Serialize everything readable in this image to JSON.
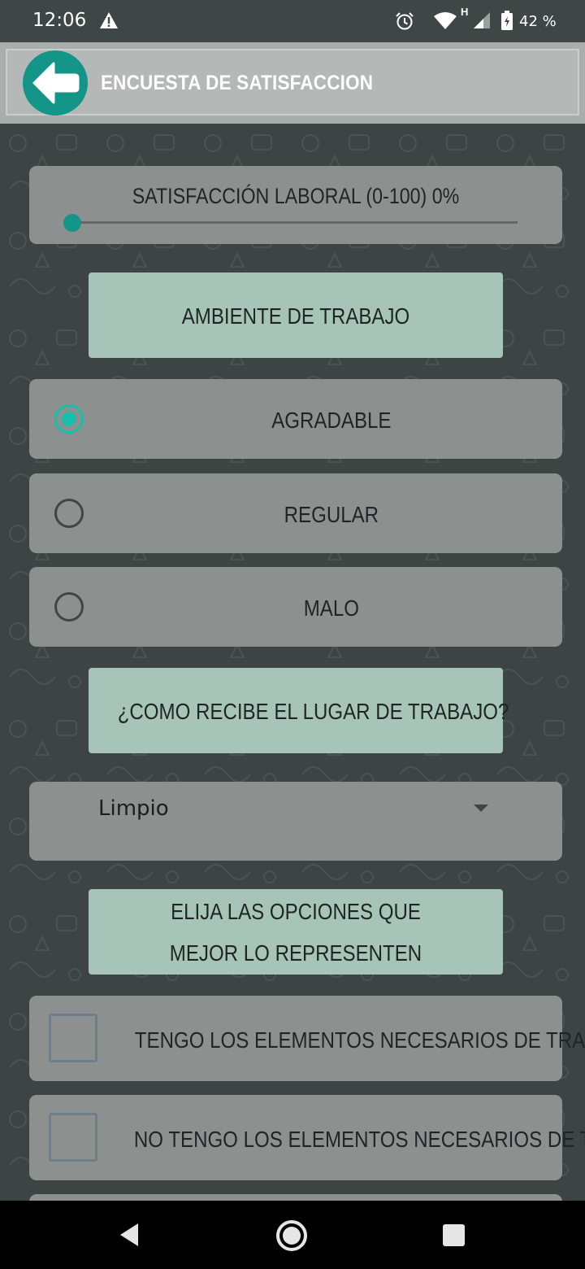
{
  "status_bar": {
    "time": "12:06",
    "network_type": "H",
    "battery_percent": "42 %",
    "icons": [
      "warning-icon",
      "alarm-icon",
      "wifi-icon",
      "signal-icon",
      "battery-icon"
    ]
  },
  "app_bar": {
    "title": "ENCUESTA DE SATISFACCION",
    "back_icon": "arrow-left-icon",
    "accent_color": "#139688"
  },
  "slider": {
    "label": "SATISFACCIÓN LABORAL (0-100) 0%",
    "value": 0,
    "min": 0,
    "max": 100
  },
  "section_ambiente": {
    "title": "AMBIENTE DE TRABAJO"
  },
  "radio_options": [
    {
      "label": "AGRADABLE",
      "checked": true
    },
    {
      "label": "REGULAR",
      "checked": false
    },
    {
      "label": "MALO",
      "checked": false
    }
  ],
  "section_lugar": {
    "title": "¿COMO RECIBE EL LUGAR DE TRABAJO?"
  },
  "spinner": {
    "selected": "Limpio"
  },
  "section_opciones": {
    "title_line1": "ELIJA LAS OPCIONES QUE",
    "title_line2": "MEJOR LO REPRESENTEN"
  },
  "checkboxes": [
    {
      "label": "TENGO LOS ELEMENTOS NECESARIOS DE TRABAJO",
      "checked": false
    },
    {
      "label": "NO TENGO LOS ELEMENTOS NECESARIOS DE TRABAJO",
      "checked": false
    }
  ],
  "nav_bar": {
    "icons": [
      "nav-back-icon",
      "nav-home-icon",
      "nav-recents-icon"
    ]
  }
}
